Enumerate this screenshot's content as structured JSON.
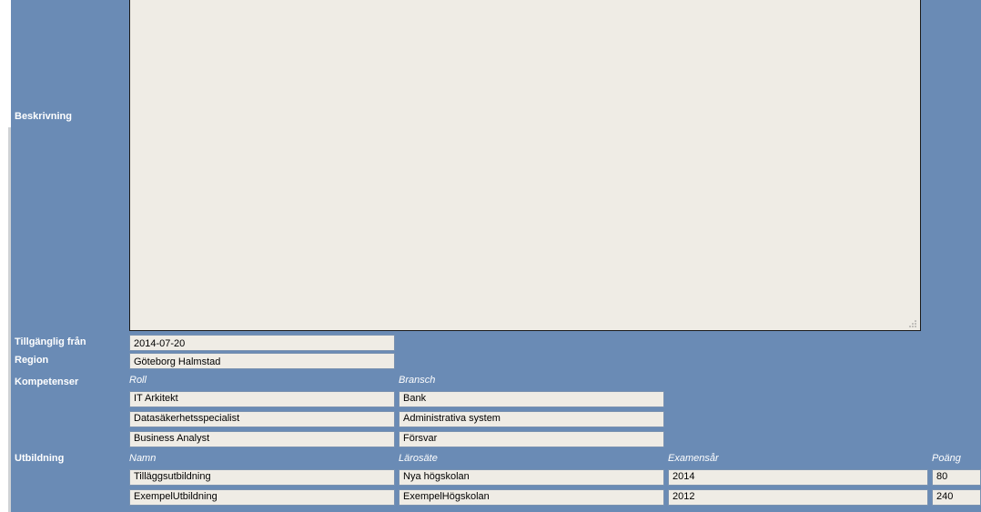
{
  "labels": {
    "beskrivning": "Beskrivning",
    "tillganglig_fran": "Tillgänglig från",
    "region": "Region",
    "kompetenser": "Kompetenser",
    "utbildning": "Utbildning"
  },
  "fields": {
    "beskrivning_value": "",
    "tillganglig_fran": "2014-07-20",
    "region": "Göteborg Halmstad"
  },
  "kompetenser": {
    "head_roll": "Roll",
    "head_bransch": "Bransch",
    "rows": [
      {
        "roll": "IT Arkitekt",
        "bransch": "Bank"
      },
      {
        "roll": "Datasäkerhetsspecialist",
        "bransch": "Administrativa system"
      },
      {
        "roll": "Business Analyst",
        "bransch": "Försvar"
      }
    ]
  },
  "utbildning": {
    "head_namn": "Namn",
    "head_larosate": "Lärosäte",
    "head_examensar": "Examensår",
    "head_poang": "Poäng",
    "rows": [
      {
        "namn": "Tilläggsutbildning",
        "larosate": "Nya högskolan",
        "examensar": "2014",
        "poang": "80"
      },
      {
        "namn": "ExempelUtbildning",
        "larosate": "ExempelHögskolan",
        "examensar": "2012",
        "poang": "240"
      }
    ]
  }
}
